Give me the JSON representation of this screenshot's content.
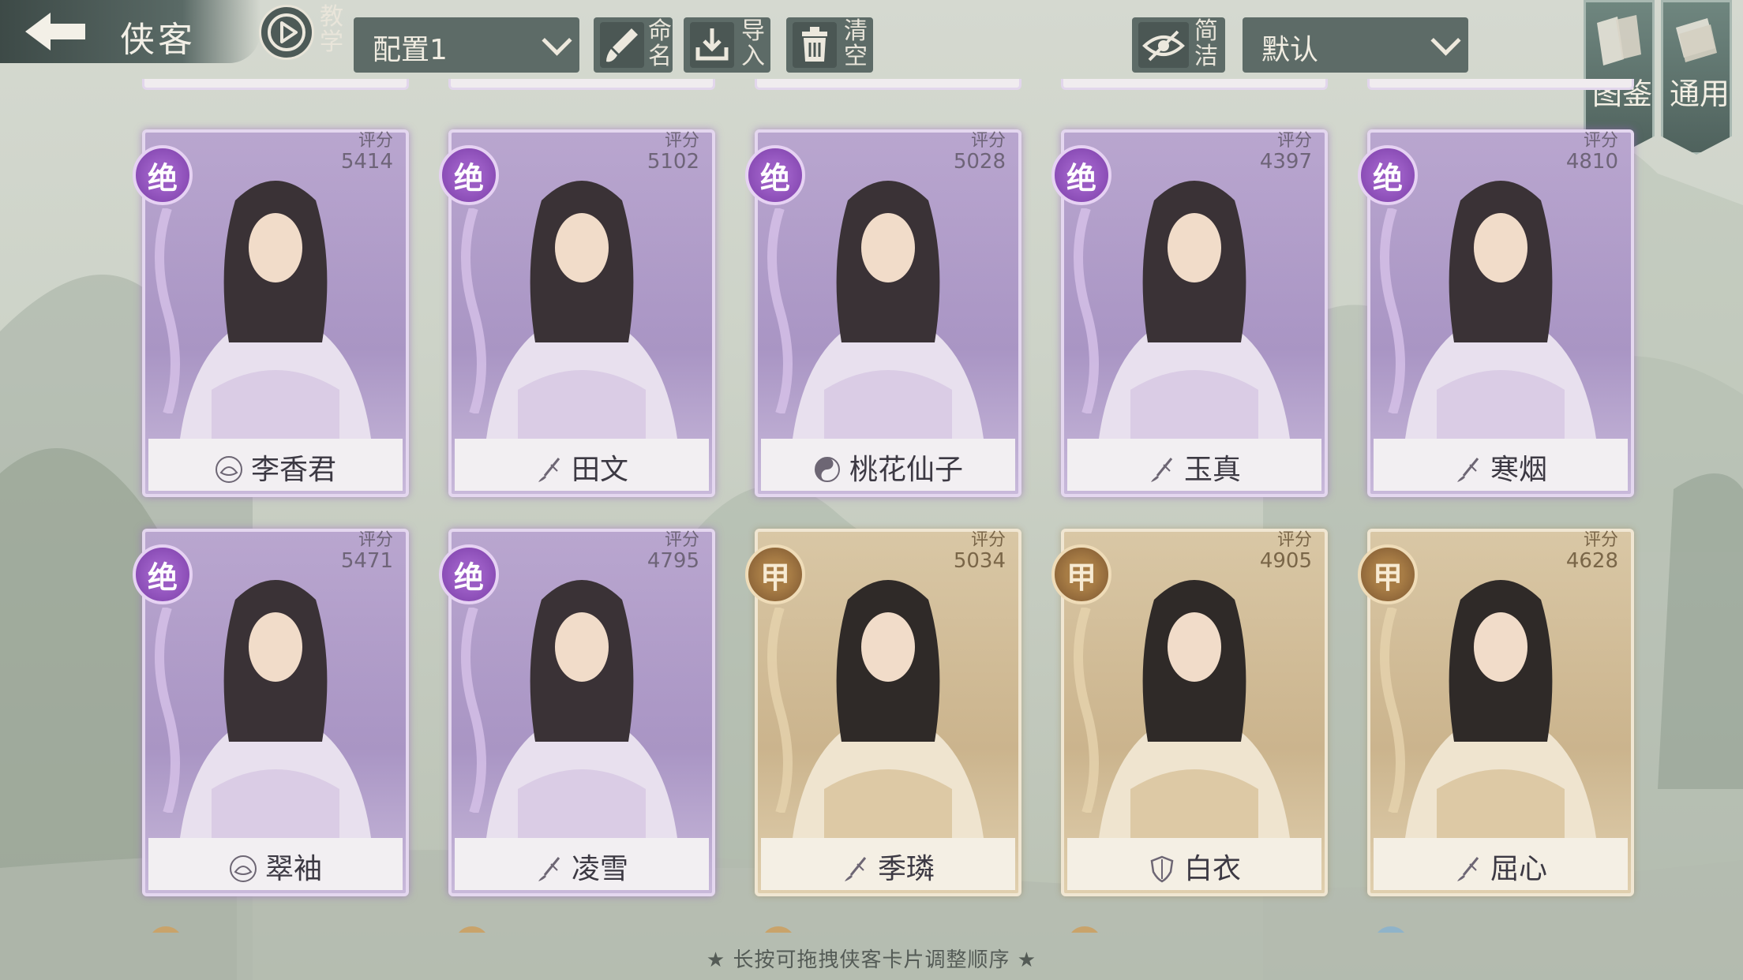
{
  "header": {
    "title": "侠客",
    "tutorial_label": "教学",
    "config_value": "配置1",
    "rename_label": "命名",
    "import_label": "导入",
    "clear_label": "清空",
    "simple_label": "简洁",
    "sort_value": "默认",
    "codex_label": "图鉴",
    "general_label": "通用"
  },
  "cards": [
    {
      "name": "李香君",
      "grade": "绝",
      "score_label": "评分",
      "score": "5414",
      "rarity": "purple",
      "faction_icon": "lotus-icon"
    },
    {
      "name": "田文",
      "grade": "绝",
      "score_label": "评分",
      "score": "5102",
      "rarity": "purple",
      "faction_icon": "brush-icon"
    },
    {
      "name": "桃花仙子",
      "grade": "绝",
      "score_label": "评分",
      "score": "5028",
      "rarity": "purple",
      "faction_icon": "yinyang-icon"
    },
    {
      "name": "玉真",
      "grade": "绝",
      "score_label": "评分",
      "score": "4397",
      "rarity": "purple",
      "faction_icon": "brush-icon"
    },
    {
      "name": "寒烟",
      "grade": "绝",
      "score_label": "评分",
      "score": "4810",
      "rarity": "purple",
      "faction_icon": "brush-icon"
    },
    {
      "name": "翠袖",
      "grade": "绝",
      "score_label": "评分",
      "score": "5471",
      "rarity": "purple",
      "faction_icon": "lotus-icon"
    },
    {
      "name": "凌雪",
      "grade": "绝",
      "score_label": "评分",
      "score": "4795",
      "rarity": "purple",
      "faction_icon": "brush-icon"
    },
    {
      "name": "季璘",
      "grade": "甲",
      "score_label": "评分",
      "score": "5034",
      "rarity": "gold",
      "faction_icon": "brush-icon"
    },
    {
      "name": "白衣",
      "grade": "甲",
      "score_label": "评分",
      "score": "4905",
      "rarity": "gold",
      "faction_icon": "shield-icon"
    },
    {
      "name": "屈心",
      "grade": "甲",
      "score_label": "评分",
      "score": "4628",
      "rarity": "gold",
      "faction_icon": "brush-icon"
    }
  ],
  "footer": {
    "hint": "★ 长按可拖拽侠客卡片调整顺序 ★"
  },
  "colors": {
    "purple_frame": "#b9a6cf",
    "gold_frame": "#d9c7a5",
    "toolbar": "#5d6b67"
  }
}
